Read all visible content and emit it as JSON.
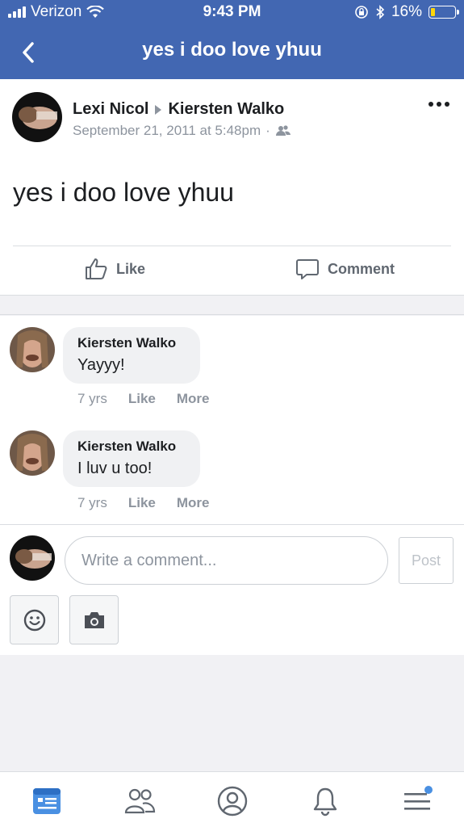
{
  "status_bar": {
    "carrier": "Verizon",
    "time": "9:43 PM",
    "battery": "16%"
  },
  "nav": {
    "title": "yes i doo love yhuu"
  },
  "post": {
    "author": "Lexi Nicol",
    "recipient": "Kiersten Walko",
    "timestamp": "September 21, 2011 at 5:48pm",
    "separator": "·",
    "text": "yes i doo love yhuu",
    "like_label": "Like",
    "comment_label": "Comment"
  },
  "comments": [
    {
      "name": "Kiersten Walko",
      "text": "Yayyy!",
      "age": "7 yrs",
      "like": "Like",
      "more": "More"
    },
    {
      "name": "Kiersten Walko",
      "text": "I luv u too!",
      "age": "7 yrs",
      "like": "Like",
      "more": "More"
    }
  ],
  "composer": {
    "placeholder": "Write a comment...",
    "post_label": "Post"
  },
  "tabs": [
    {
      "icon": "news-feed-icon",
      "active": true
    },
    {
      "icon": "friends-icon"
    },
    {
      "icon": "profile-icon"
    },
    {
      "icon": "notifications-icon"
    },
    {
      "icon": "menu-icon",
      "badge": true
    }
  ],
  "colors": {
    "brand": "#4267b2",
    "active_tab": "#4a90e2",
    "muted": "#8d949e"
  }
}
